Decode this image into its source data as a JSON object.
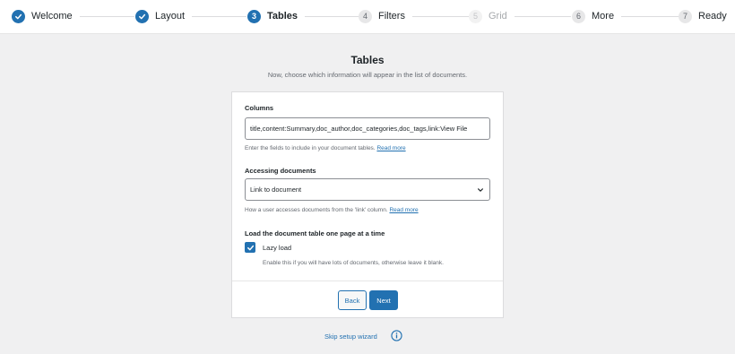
{
  "stepper": {
    "steps": [
      {
        "number": "1",
        "label": "Welcome",
        "state": "done"
      },
      {
        "number": "2",
        "label": "Layout",
        "state": "done"
      },
      {
        "number": "3",
        "label": "Tables",
        "state": "current"
      },
      {
        "number": "4",
        "label": "Filters",
        "state": "pending"
      },
      {
        "number": "5",
        "label": "Grid",
        "state": "disabled"
      },
      {
        "number": "6",
        "label": "More",
        "state": "pending"
      },
      {
        "number": "7",
        "label": "Ready",
        "state": "pending"
      }
    ]
  },
  "header": {
    "title": "Tables",
    "subtitle": "Now, choose which information will appear in the list of documents."
  },
  "form": {
    "columns": {
      "label": "Columns",
      "value": "title,content:Summary,doc_author,doc_categories,doc_tags,link:View File",
      "help": "Enter the fields to include in your document tables.",
      "read_more": "Read more"
    },
    "accessing": {
      "label": "Accessing documents",
      "selected": "Link to document",
      "help": "How a user accesses documents from the 'link' column.",
      "read_more": "Read more"
    },
    "lazy": {
      "label": "Load the document table one page at a time",
      "checkbox_label": "Lazy load",
      "checked": true,
      "help": "Enable this if you will have lots of documents, otherwise leave it blank."
    }
  },
  "buttons": {
    "back": "Back",
    "next": "Next"
  },
  "footer": {
    "skip": "Skip setup wizard"
  },
  "colors": {
    "accent": "#2271b1",
    "background": "#f0f0f1"
  }
}
